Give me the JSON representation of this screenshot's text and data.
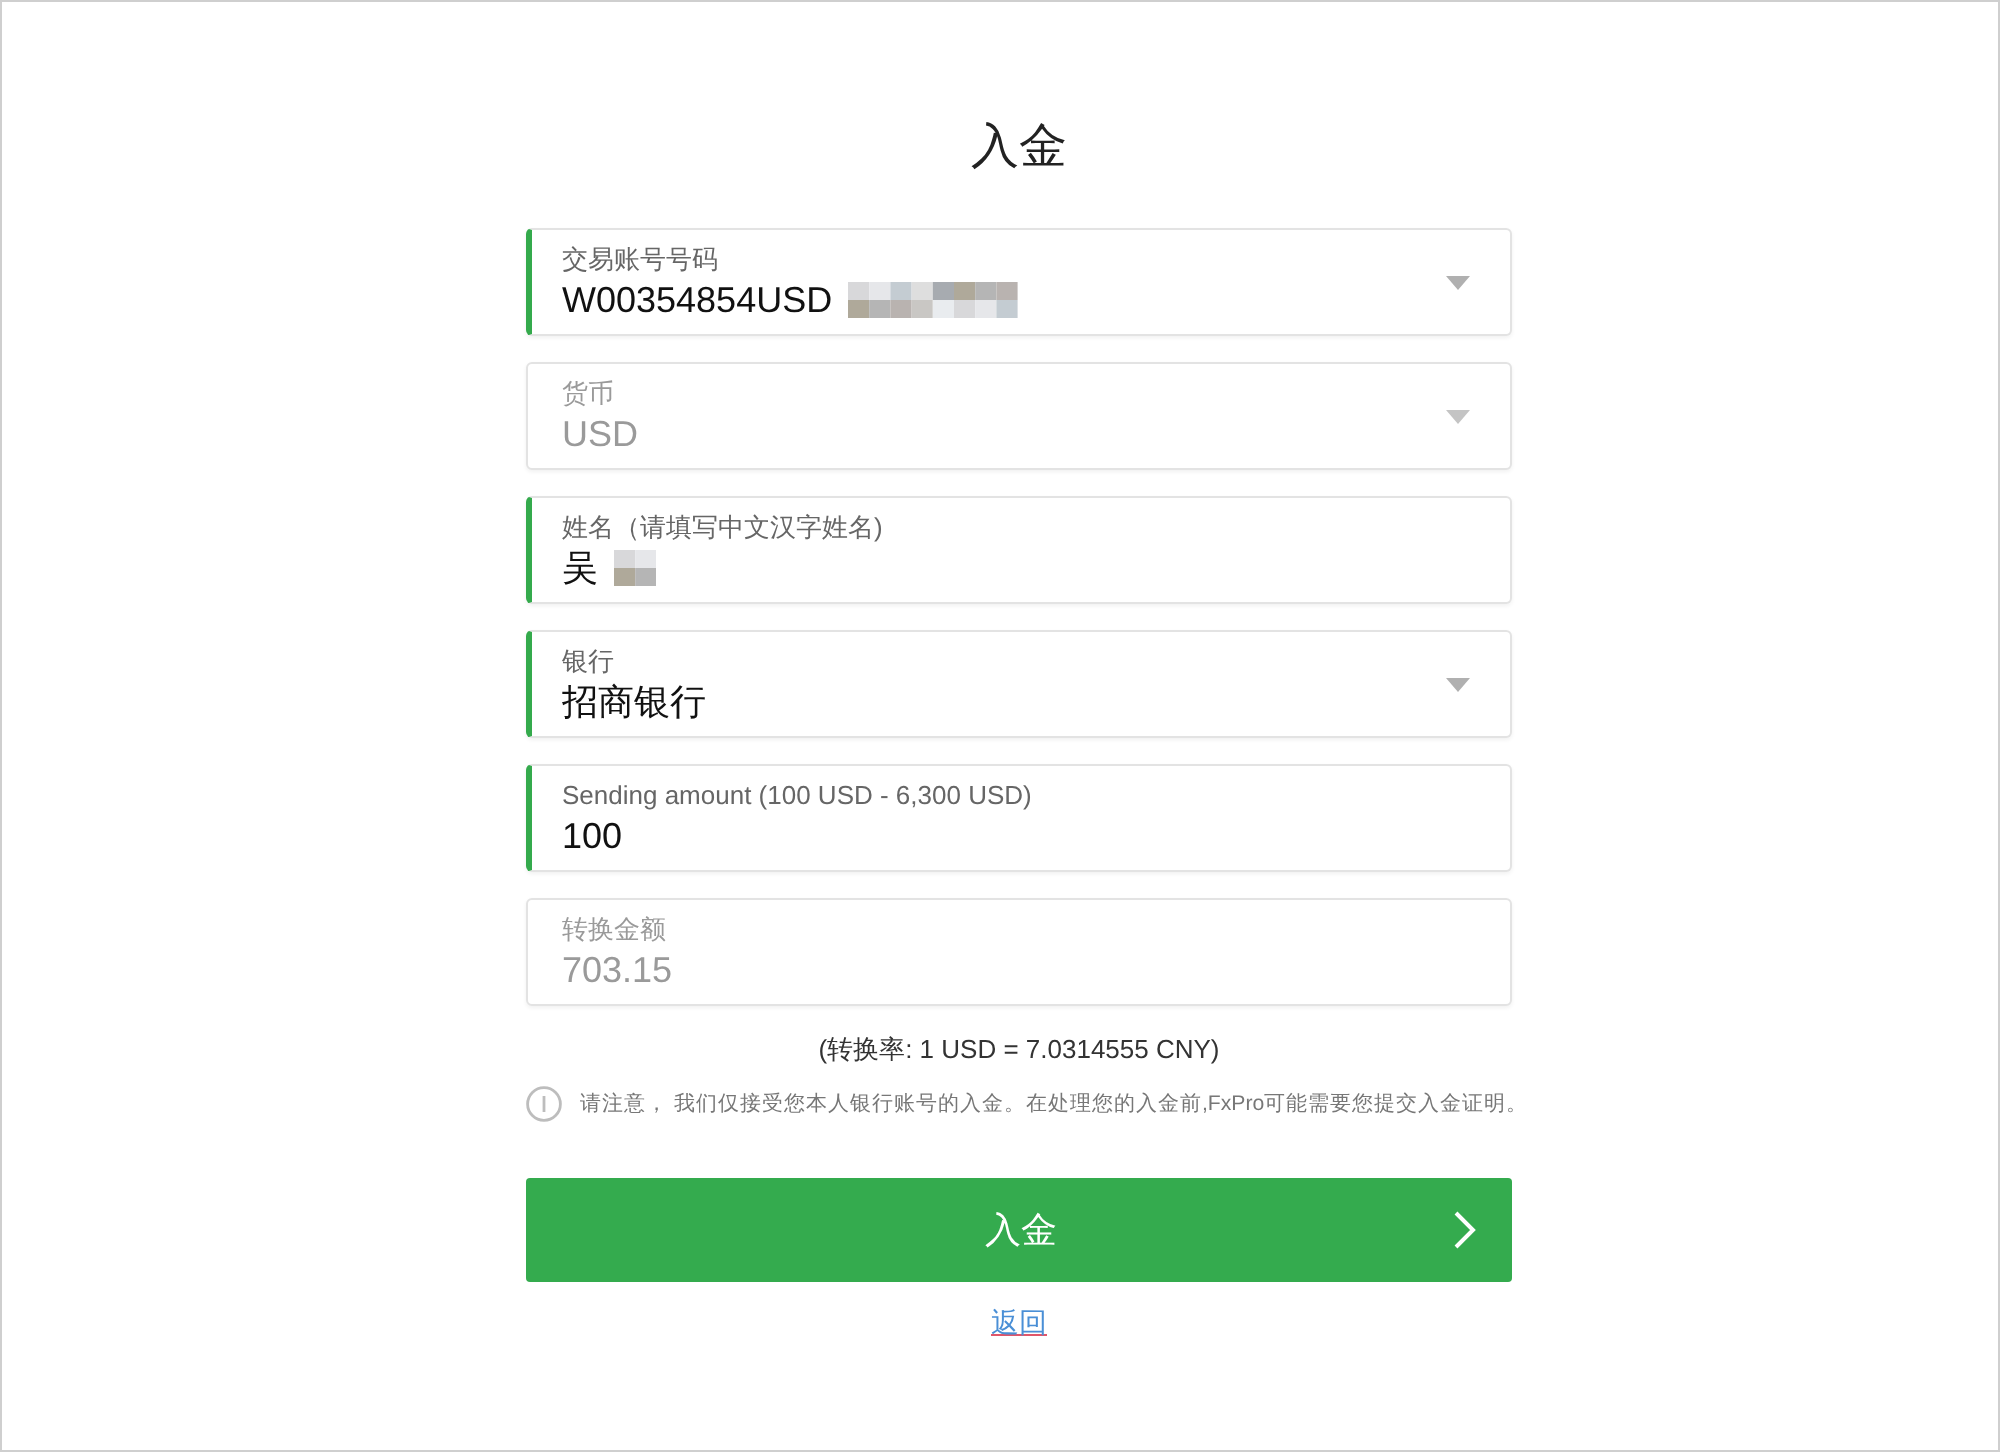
{
  "page": {
    "title": "入金"
  },
  "fields": [
    {
      "kind": "select",
      "label": "交易账号号码",
      "value": "W00354854USD",
      "validated": true,
      "disabled": false,
      "redacted": true
    },
    {
      "kind": "select",
      "label": "货币",
      "value": "USD",
      "validated": false,
      "disabled": true
    },
    {
      "kind": "text",
      "label": "姓名（请填写中文汉字姓名)",
      "value": "吴",
      "validated": true,
      "disabled": false,
      "redacted": true
    },
    {
      "kind": "select",
      "label": "银行",
      "value": "招商银行",
      "validated": true,
      "disabled": false
    },
    {
      "kind": "text",
      "label": "Sending amount (100 USD - 6,300 USD)",
      "value": "100",
      "validated": true,
      "disabled": false
    },
    {
      "kind": "text",
      "label": "转换金额",
      "value": "703.15",
      "validated": false,
      "disabled": true
    }
  ],
  "rate_note": "(转换率: 1 USD = 7.0314555 CNY)",
  "notice": "请注意， 我们仅接受您本人银行账号的入金。在处理您的入金前,FxPro可能需要您提交入金证明。",
  "submit_button": {
    "label": "入金"
  },
  "back_link": "返回"
}
